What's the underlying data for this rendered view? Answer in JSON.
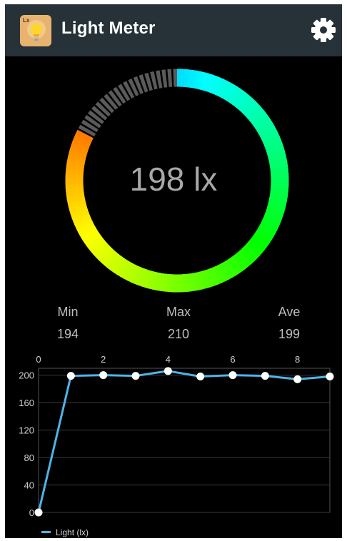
{
  "app": {
    "title": "Light Meter",
    "icon": "lightbulb-icon",
    "icon_tag": "Lx",
    "settings_icon": "gear-icon"
  },
  "meter": {
    "reading": "198 lx"
  },
  "stats": {
    "min_label": "Min",
    "min_value": "194",
    "max_label": "Max",
    "max_value": "210",
    "ave_label": "Ave",
    "ave_value": "199"
  },
  "colors": {
    "appbar": "#263238",
    "background": "#000000",
    "line": "#4fb3e6",
    "point": "#ffffff"
  },
  "chart_data": {
    "type": "line",
    "x": [
      0,
      1,
      2,
      3,
      4,
      5,
      6,
      7,
      8,
      9
    ],
    "series": [
      {
        "name": "Light  (lx)",
        "values": [
          0,
          199,
          200,
          199,
          206,
          198,
          200,
          199,
          194,
          198
        ]
      }
    ],
    "x_ticks": [
      "0",
      "2",
      "4",
      "6",
      "8"
    ],
    "y_ticks": [
      "0",
      "40",
      "80",
      "120",
      "160",
      "200"
    ],
    "xlim": [
      0,
      9
    ],
    "ylim": [
      0,
      210
    ],
    "x_axis_position": "top",
    "grid": true,
    "legend": "bottom-left"
  }
}
